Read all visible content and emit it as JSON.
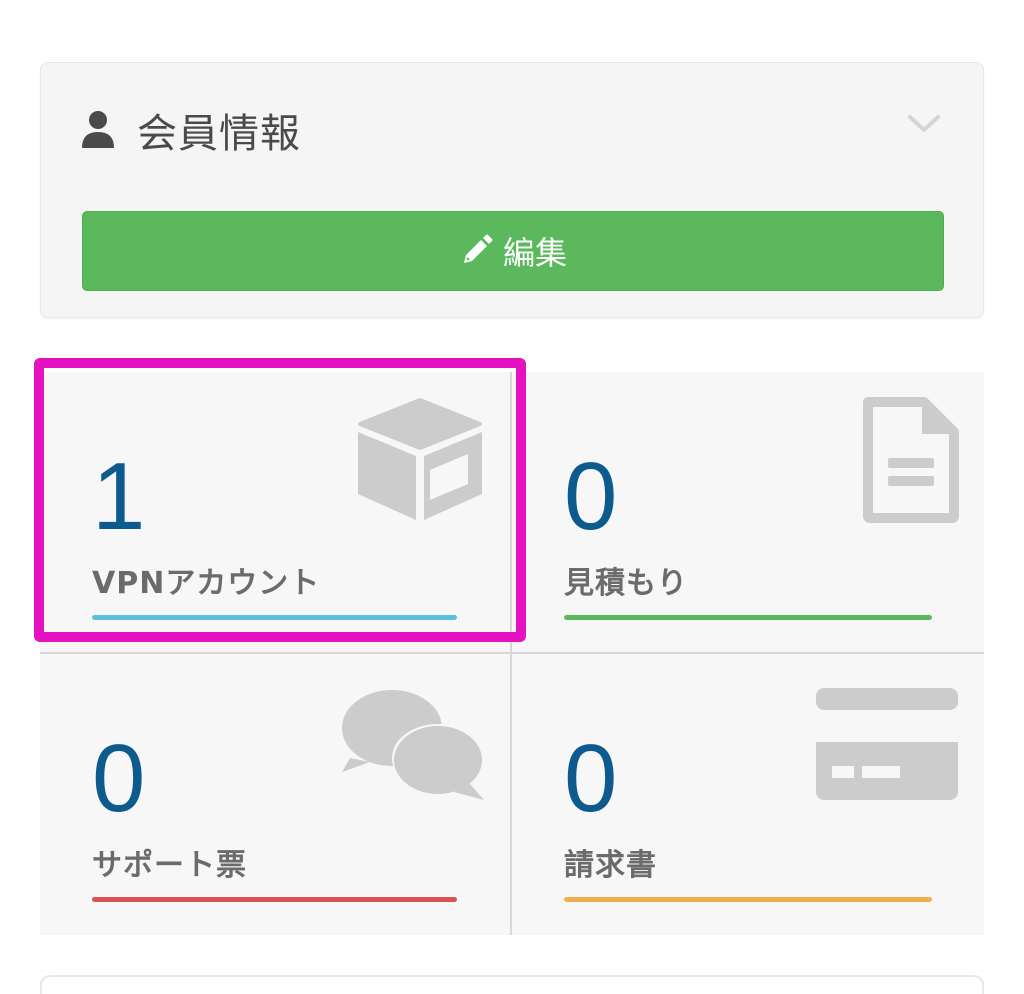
{
  "member_panel": {
    "title": "会員情報",
    "icons": {
      "header": "user-icon",
      "collapse": "chevron-down-icon"
    },
    "edit_button": {
      "label": "編集",
      "icon": "pencil-icon",
      "color": "#5cb85c"
    }
  },
  "stats": [
    {
      "key": "vpn",
      "count": "1",
      "label": "VPNアカウント",
      "icon": "cube-icon",
      "bar_color": "#5bc0de",
      "highlighted": true
    },
    {
      "key": "quotes",
      "count": "0",
      "label": "見積もり",
      "icon": "document-icon",
      "bar_color": "#5cb85c"
    },
    {
      "key": "tickets",
      "count": "0",
      "label": "サポート票",
      "icon": "chat-bubbles-icon",
      "bar_color": "#d9534f"
    },
    {
      "key": "invoices",
      "count": "0",
      "label": "請求書",
      "icon": "credit-card-icon",
      "bar_color": "#f0ad4e"
    }
  ],
  "colors": {
    "count_text": "#0d5a8f",
    "highlight": "#e512c2",
    "icon_gray": "#cccccc"
  }
}
